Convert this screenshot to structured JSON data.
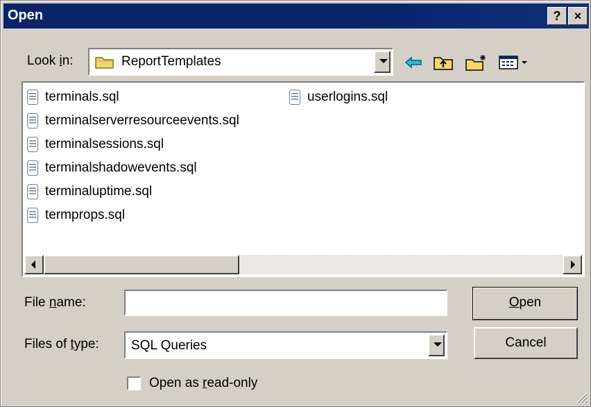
{
  "window": {
    "title": "Open",
    "help_btn": "?",
    "close_btn": "×"
  },
  "lookin": {
    "label_pre": "Look ",
    "label_u": "i",
    "label_post": "n:",
    "value": "ReportTemplates"
  },
  "toolbar": {
    "back_icon": "back-arrow-icon",
    "up_icon": "up-one-level-icon",
    "new_folder_icon": "new-folder-icon",
    "view_icon": "view-menu-icon"
  },
  "files": {
    "col1": [
      "terminals.sql",
      "terminalserverresourceevents.sql",
      "terminalsessions.sql",
      "terminalshadowevents.sql",
      "terminaluptime.sql",
      "termprops.sql"
    ],
    "col2": [
      "userlogins.sql"
    ]
  },
  "filename": {
    "label_pre": "File ",
    "label_u": "n",
    "label_post": "ame:",
    "value": ""
  },
  "filetype": {
    "label_pre": "Files of ",
    "label_u": "t",
    "label_post": "ype:",
    "value": "SQL Queries"
  },
  "buttons": {
    "open_u": "O",
    "open_rest": "pen",
    "cancel": "Cancel"
  },
  "readonly": {
    "label_pre": "Open as ",
    "label_u": "r",
    "label_post": "ead-only",
    "checked": false
  },
  "colors": {
    "titlebar": "#0a246a",
    "face": "#d4d0c8",
    "folder": "#f5d66b"
  }
}
